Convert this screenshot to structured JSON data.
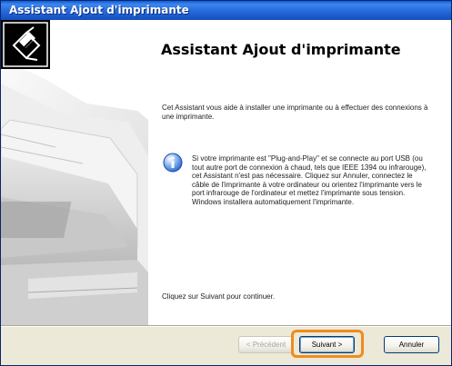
{
  "window": {
    "title": "Assistant Ajout d'imprimante"
  },
  "wizard": {
    "icon": "printer-wizard-icon",
    "heading": "Assistant Ajout d'imprimante",
    "intro": "Cet Assistant vous aide à installer une imprimante ou à effectuer des connexions à une imprimante.",
    "info_icon": "info-icon",
    "info": "Si votre imprimante est \"Plug-and-Play\" et se connecte au port USB (ou tout autre port de connexion à chaud, tels que IEEE 1394 ou infrarouge), cet Assistant n'est pas nécessaire. Cliquez sur Annuler, connectez le câble de l'imprimante à votre ordinateur ou orientez l'imprimante vers le port infrarouge de l'ordinateur et mettez l'imprimante sous tension. Windows installera automatiquement l'imprimante.",
    "continue": "Cliquez sur Suivant pour continuer."
  },
  "buttons": {
    "prev": "< Précédent",
    "next": "Suivant >",
    "cancel": "Annuler"
  },
  "colors": {
    "titlebar": "#2a6fe0",
    "highlight": "#f08b1d"
  }
}
